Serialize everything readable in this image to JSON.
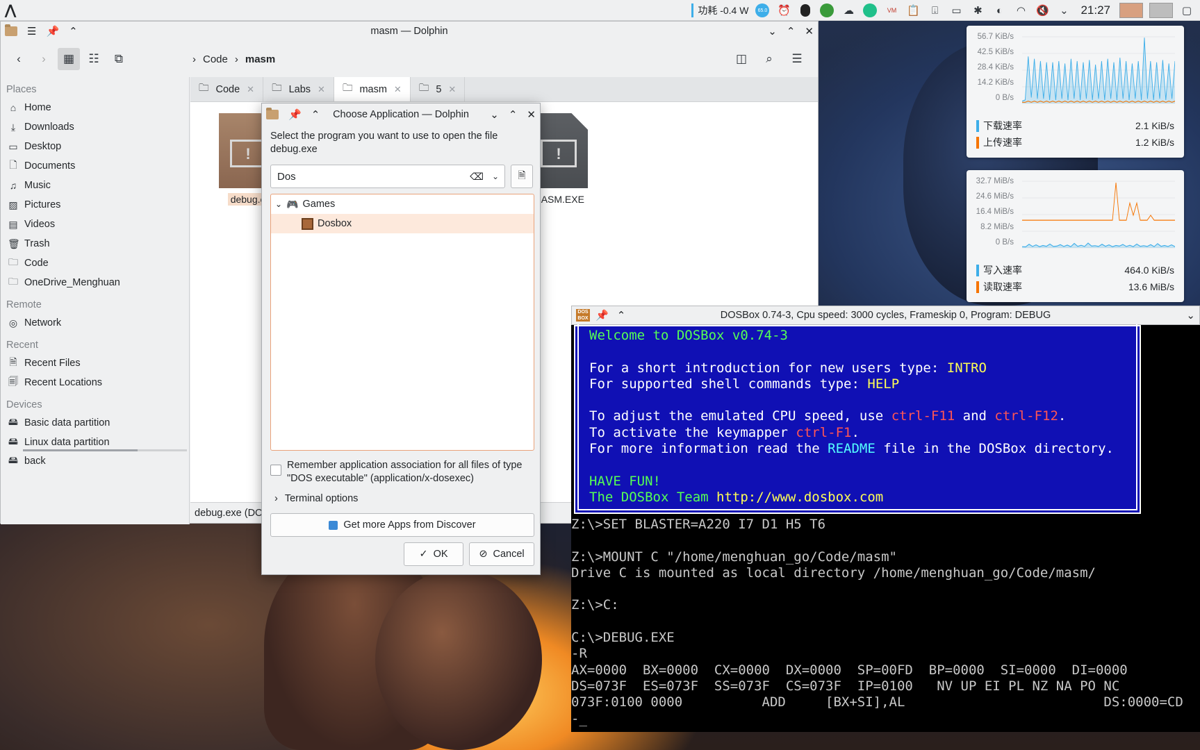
{
  "panel": {
    "power_label": "功耗 -0.4 W",
    "speed_badge": "65.0",
    "clock": "21:27"
  },
  "dolphin": {
    "title": "masm — Dolphin",
    "breadcrumb": [
      "Code",
      "masm"
    ],
    "places": {
      "sections": {
        "places": "Places",
        "remote": "Remote",
        "recent": "Recent",
        "devices": "Devices"
      },
      "places_items": [
        {
          "label": "Home",
          "icon": "home-icon"
        },
        {
          "label": "Downloads",
          "icon": "downloads-icon"
        },
        {
          "label": "Desktop",
          "icon": "desktop-icon"
        },
        {
          "label": "Documents",
          "icon": "documents-icon"
        },
        {
          "label": "Music",
          "icon": "music-icon"
        },
        {
          "label": "Pictures",
          "icon": "pictures-icon"
        },
        {
          "label": "Videos",
          "icon": "videos-icon"
        },
        {
          "label": "Trash",
          "icon": "trash-icon"
        },
        {
          "label": "Code",
          "icon": "folder-icon"
        },
        {
          "label": "OneDrive_Menghuan",
          "icon": "folder-icon"
        }
      ],
      "remote_items": [
        {
          "label": "Network",
          "icon": "network-icon"
        }
      ],
      "recent_items": [
        {
          "label": "Recent Files",
          "icon": "recent-files-icon"
        },
        {
          "label": "Recent Locations",
          "icon": "recent-locations-icon"
        }
      ],
      "device_items": [
        {
          "label": "Basic data partition",
          "icon": "drive-icon"
        },
        {
          "label": "Linux data partition",
          "icon": "drive-icon"
        },
        {
          "label": "back",
          "icon": "drive-icon"
        }
      ],
      "linux_partition_usage": 0.7
    },
    "tabs": [
      {
        "label": "Code"
      },
      {
        "label": "Labs"
      },
      {
        "label": "masm"
      },
      {
        "label": "5"
      }
    ],
    "active_tab": "masm",
    "files": [
      {
        "name": "debug.e",
        "selected": true
      },
      {
        "name": "MASM.EXE",
        "selected": false
      }
    ],
    "status": "debug.exe (DO"
  },
  "dialog": {
    "title": "Choose Application — Dolphin",
    "prompt_line1": "Select the program you want to use to open the file",
    "prompt_line2": "debug.exe",
    "search_value": "Dos",
    "tree": {
      "group": "Games",
      "app": "Dosbox"
    },
    "remember_line1": "Remember application association for all files of type",
    "remember_line2": "\"DOS executable\" (application/x-dosexec)",
    "terminal_options": "Terminal options",
    "discover_label": "Get more Apps from Discover",
    "ok_label": "OK",
    "cancel_label": "Cancel"
  },
  "monitor_net": {
    "y_ticks": [
      "56.7 KiB/s",
      "42.5 KiB/s",
      "28.4 KiB/s",
      "14.2 KiB/s",
      "0 B/s"
    ],
    "legend": [
      {
        "label": "下载速率",
        "value": "2.1 KiB/s",
        "color": "#3daee9"
      },
      {
        "label": "上传速率",
        "value": "1.2 KiB/s",
        "color": "#f67400"
      }
    ],
    "series_down": [
      2,
      3,
      40,
      5,
      38,
      4,
      36,
      4,
      35,
      3,
      35,
      3,
      36,
      4,
      34,
      3,
      38,
      4,
      36,
      3,
      35,
      4,
      37,
      3,
      33,
      4,
      36,
      3,
      38,
      4,
      35,
      3,
      39,
      4,
      36,
      3,
      34,
      4,
      36,
      3,
      56,
      4,
      36,
      3,
      35,
      4,
      37,
      3,
      34,
      4,
      36
    ],
    "series_up": [
      1,
      1,
      2,
      1,
      2,
      1,
      2,
      1,
      2,
      1,
      2,
      1,
      2,
      1,
      2,
      1,
      2,
      1,
      2,
      1,
      2,
      1,
      2,
      1,
      2,
      1,
      2,
      1,
      2,
      1,
      2,
      1,
      2,
      1,
      2,
      1,
      2,
      1,
      2,
      1,
      2,
      1,
      2,
      1,
      2,
      1,
      2,
      1,
      2,
      1,
      2
    ]
  },
  "monitor_disk": {
    "y_ticks": [
      "32.7 MiB/s",
      "24.6 MiB/s",
      "16.4 MiB/s",
      "8.2 MiB/s",
      "0 B/s"
    ],
    "legend": [
      {
        "label": "写入速率",
        "value": "464.0 KiB/s",
        "color": "#3daee9"
      },
      {
        "label": "读取速率",
        "value": "13.6 MiB/s",
        "color": "#f67400"
      }
    ],
    "series_write": [
      0.6,
      0.5,
      1.8,
      0.7,
      1.5,
      0.6,
      1.2,
      0.8,
      1.9,
      0.7,
      0.9,
      1.6,
      0.7,
      1.4,
      0.6,
      2.2,
      0.8,
      1.3,
      0.7,
      2.4,
      0.9,
      1.1,
      0.7,
      1.8,
      0.8,
      1.5,
      0.6,
      1.2,
      0.9,
      1.7,
      0.7,
      1.3,
      0.6,
      1.9,
      0.8,
      1.1,
      0.7,
      1.6,
      0.6,
      2.1,
      0.8,
      1.2,
      0.7,
      1.5,
      0.6
    ],
    "series_read": [
      13.6,
      13.6,
      13.6,
      13.6,
      13.6,
      13.6,
      13.6,
      13.6,
      13.6,
      13.6,
      13.6,
      13.6,
      13.6,
      13.6,
      13.6,
      13.6,
      13.6,
      13.6,
      13.6,
      13.6,
      13.6,
      13.6,
      13.6,
      13.6,
      13.6,
      13.6,
      13.6,
      32,
      13.6,
      13.6,
      13.6,
      22,
      16,
      22,
      13.6,
      13.6,
      13.6,
      16,
      13.6,
      13.6,
      13.6,
      13.6,
      13.6,
      13.6,
      13.6
    ]
  },
  "dosbox": {
    "title": "DOSBox 0.74-3, Cpu speed:   3000 cycles, Frameskip  0, Program:   DEBUG",
    "welcome": {
      "l1": "Welcome to DOSBox v0.74-3",
      "l2a": "For a short introduction for new users type: ",
      "l2b": "INTRO",
      "l3a": "For supported shell commands type: ",
      "l3b": "HELP",
      "l4a": "To adjust the emulated CPU speed, use ",
      "l4b": "ctrl-F11",
      "l4c": " and ",
      "l4d": "ctrl-F12",
      "l4e": ".",
      "l5a": "To activate the keymapper ",
      "l5b": "ctrl-F1",
      "l5c": ".",
      "l6a": "For more information read the ",
      "l6b": "README",
      "l6c": " file in the DOSBox directory.",
      "l7": "HAVE FUN!",
      "l8a": "The DOSBox Team ",
      "l8b": "http://www.dosbox.com"
    },
    "console": [
      "Z:\\>SET BLASTER=A220 I7 D1 H5 T6",
      "",
      "Z:\\>MOUNT C \"/home/menghuan_go/Code/masm\"",
      "Drive C is mounted as local directory /home/menghuan_go/Code/masm/",
      "",
      "Z:\\>C:",
      "",
      "C:\\>DEBUG.EXE",
      "-R",
      "AX=0000  BX=0000  CX=0000  DX=0000  SP=00FD  BP=0000  SI=0000  DI=0000",
      "DS=073F  ES=073F  SS=073F  CS=073F  IP=0100   NV UP EI PL NZ NA PO NC",
      "073F:0100 0000          ADD     [BX+SI],AL                         DS:0000=CD",
      "-_"
    ]
  }
}
